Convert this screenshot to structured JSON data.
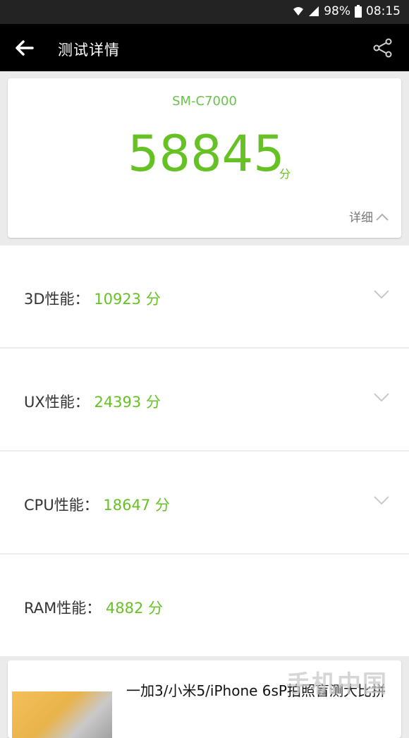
{
  "status_bar": {
    "battery": "98%",
    "time": "08:15"
  },
  "app_bar": {
    "title": "测试详情"
  },
  "score_card": {
    "model": "SM-C7000",
    "total_score": "58845",
    "unit": "分",
    "detail_label": "详细"
  },
  "rows": [
    {
      "label": "3D性能：",
      "value": "10923 分"
    },
    {
      "label": "UX性能：",
      "value": "24393 分"
    },
    {
      "label": "CPU性能：",
      "value": "18647 分"
    },
    {
      "label": "RAM性能：",
      "value": "4882 分"
    }
  ],
  "ad": {
    "title": "一加3/小米5/iPhone 6sP拍照盲测大比拼"
  },
  "watermark": {
    "text": "手机中国"
  }
}
